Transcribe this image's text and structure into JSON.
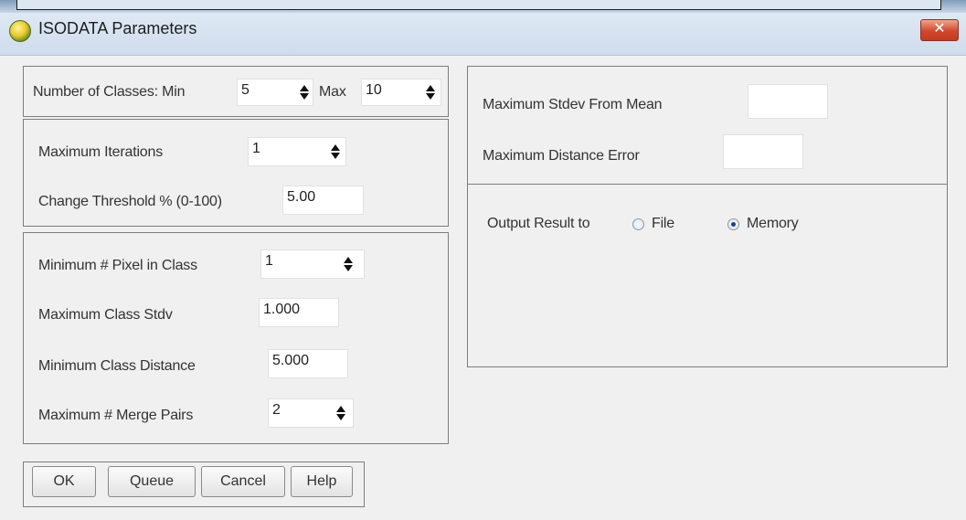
{
  "window": {
    "title": "ISODATA Parameters",
    "close_glyph": "✕"
  },
  "classes": {
    "label": "Number of Classes: Min",
    "min_value": "5",
    "max_label": "Max",
    "max_value": "10"
  },
  "iterations": {
    "max_iter_label": "Maximum Iterations",
    "max_iter_value": "1",
    "threshold_label": "Change Threshold % (0-100)",
    "threshold_value": "5.00"
  },
  "class_params": {
    "min_pixel_label": "Minimum # Pixel in Class",
    "min_pixel_value": "1",
    "max_stdv_label": "Maximum Class Stdv",
    "max_stdv_value": "1.000",
    "min_dist_label": "Minimum Class Distance",
    "min_dist_value": "5.000",
    "merge_pairs_label": "Maximum # Merge Pairs",
    "merge_pairs_value": "2"
  },
  "stdev": {
    "max_stdev_label": "Maximum Stdev From Mean",
    "max_stdev_value": "",
    "max_dist_err_label": "Maximum Distance Error",
    "max_dist_err_value": ""
  },
  "output": {
    "label": "Output Result to",
    "options": [
      "File",
      "Memory"
    ],
    "selected": "Memory"
  },
  "buttons": {
    "ok": "OK",
    "queue": "Queue",
    "cancel": "Cancel",
    "help": "Help"
  },
  "colors": {
    "close_button": "#d0472d",
    "title_bar": "#dfe9f5",
    "dialog_bg": "#f0f0f0"
  }
}
